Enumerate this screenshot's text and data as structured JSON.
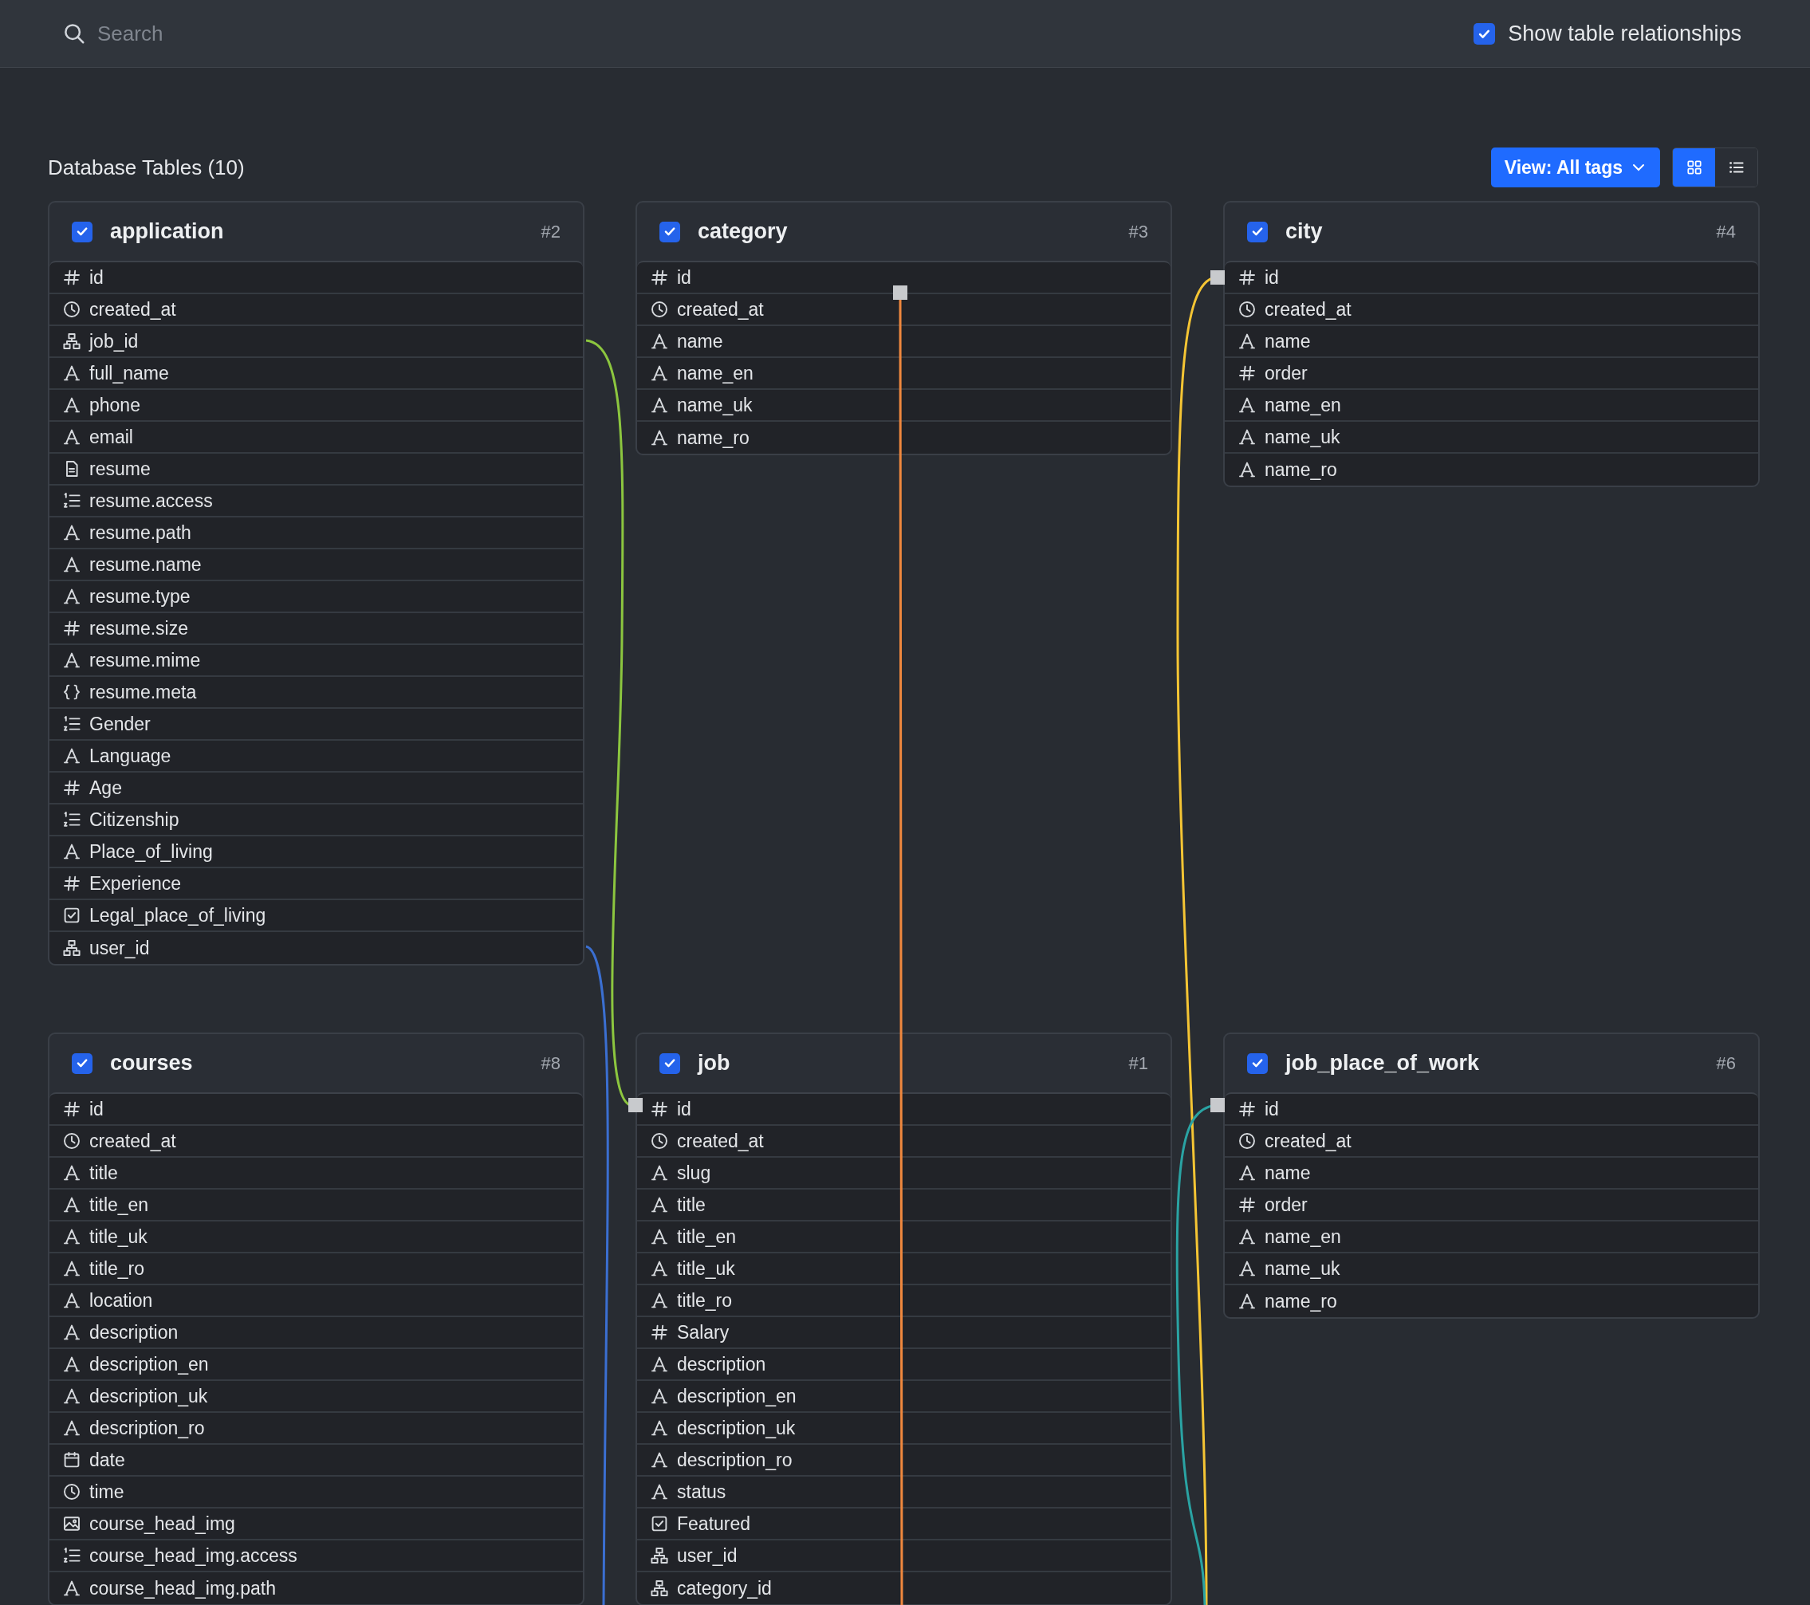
{
  "search": {
    "placeholder": "Search"
  },
  "show_relationships": {
    "label": "Show table relationships",
    "checked": true
  },
  "section_title": "Database Tables (10)",
  "view_button": {
    "label": "View: All tags"
  },
  "view_modes": [
    {
      "kind": "grid",
      "selected": true
    },
    {
      "kind": "list",
      "selected": false
    }
  ],
  "tables": [
    {
      "name": "application",
      "number": "#2",
      "checked": true,
      "fields": [
        {
          "name": "id",
          "kind": "number"
        },
        {
          "name": "created_at",
          "kind": "timestamp"
        },
        {
          "name": "job_id",
          "kind": "relation"
        },
        {
          "name": "full_name",
          "kind": "text"
        },
        {
          "name": "phone",
          "kind": "text"
        },
        {
          "name": "email",
          "kind": "text"
        },
        {
          "name": "resume",
          "kind": "file"
        },
        {
          "name": "resume.access",
          "kind": "list"
        },
        {
          "name": "resume.path",
          "kind": "text"
        },
        {
          "name": "resume.name",
          "kind": "text"
        },
        {
          "name": "resume.type",
          "kind": "text"
        },
        {
          "name": "resume.size",
          "kind": "number"
        },
        {
          "name": "resume.mime",
          "kind": "text"
        },
        {
          "name": "resume.meta",
          "kind": "json"
        },
        {
          "name": "Gender",
          "kind": "list"
        },
        {
          "name": "Language",
          "kind": "text"
        },
        {
          "name": "Age",
          "kind": "number"
        },
        {
          "name": "Citizenship",
          "kind": "list"
        },
        {
          "name": "Place_of_living",
          "kind": "text"
        },
        {
          "name": "Experience",
          "kind": "number"
        },
        {
          "name": "Legal_place_of_living",
          "kind": "boolean"
        },
        {
          "name": "user_id",
          "kind": "relation"
        }
      ]
    },
    {
      "name": "category",
      "number": "#3",
      "checked": true,
      "fields": [
        {
          "name": "id",
          "kind": "number"
        },
        {
          "name": "created_at",
          "kind": "timestamp"
        },
        {
          "name": "name",
          "kind": "text"
        },
        {
          "name": "name_en",
          "kind": "text"
        },
        {
          "name": "name_uk",
          "kind": "text"
        },
        {
          "name": "name_ro",
          "kind": "text"
        }
      ]
    },
    {
      "name": "city",
      "number": "#4",
      "checked": true,
      "fields": [
        {
          "name": "id",
          "kind": "number"
        },
        {
          "name": "created_at",
          "kind": "timestamp"
        },
        {
          "name": "name",
          "kind": "text"
        },
        {
          "name": "order",
          "kind": "number"
        },
        {
          "name": "name_en",
          "kind": "text"
        },
        {
          "name": "name_uk",
          "kind": "text"
        },
        {
          "name": "name_ro",
          "kind": "text"
        }
      ]
    },
    {
      "name": "courses",
      "number": "#8",
      "checked": true,
      "fields": [
        {
          "name": "id",
          "kind": "number"
        },
        {
          "name": "created_at",
          "kind": "timestamp"
        },
        {
          "name": "title",
          "kind": "text"
        },
        {
          "name": "title_en",
          "kind": "text"
        },
        {
          "name": "title_uk",
          "kind": "text"
        },
        {
          "name": "title_ro",
          "kind": "text"
        },
        {
          "name": "location",
          "kind": "text"
        },
        {
          "name": "description",
          "kind": "text"
        },
        {
          "name": "description_en",
          "kind": "text"
        },
        {
          "name": "description_uk",
          "kind": "text"
        },
        {
          "name": "description_ro",
          "kind": "text"
        },
        {
          "name": "date",
          "kind": "date"
        },
        {
          "name": "time",
          "kind": "timestamp"
        },
        {
          "name": "course_head_img",
          "kind": "image"
        },
        {
          "name": "course_head_img.access",
          "kind": "list"
        },
        {
          "name": "course_head_img.path",
          "kind": "text"
        }
      ]
    },
    {
      "name": "job",
      "number": "#1",
      "checked": true,
      "fields": [
        {
          "name": "id",
          "kind": "number"
        },
        {
          "name": "created_at",
          "kind": "timestamp"
        },
        {
          "name": "slug",
          "kind": "text"
        },
        {
          "name": "title",
          "kind": "text"
        },
        {
          "name": "title_en",
          "kind": "text"
        },
        {
          "name": "title_uk",
          "kind": "text"
        },
        {
          "name": "title_ro",
          "kind": "text"
        },
        {
          "name": "Salary",
          "kind": "number"
        },
        {
          "name": "description",
          "kind": "text"
        },
        {
          "name": "description_en",
          "kind": "text"
        },
        {
          "name": "description_uk",
          "kind": "text"
        },
        {
          "name": "description_ro",
          "kind": "text"
        },
        {
          "name": "status",
          "kind": "text"
        },
        {
          "name": "Featured",
          "kind": "boolean"
        },
        {
          "name": "user_id",
          "kind": "relation"
        },
        {
          "name": "category_id",
          "kind": "relation"
        }
      ]
    },
    {
      "name": "job_place_of_work",
      "number": "#6",
      "checked": true,
      "fields": [
        {
          "name": "id",
          "kind": "number"
        },
        {
          "name": "created_at",
          "kind": "timestamp"
        },
        {
          "name": "name",
          "kind": "text"
        },
        {
          "name": "order",
          "kind": "number"
        },
        {
          "name": "name_en",
          "kind": "text"
        },
        {
          "name": "name_uk",
          "kind": "text"
        },
        {
          "name": "name_ro",
          "kind": "text"
        }
      ]
    }
  ],
  "relationships": [
    {
      "color": "#8cc63f"
    },
    {
      "color": "#3b6fd1"
    },
    {
      "color": "#f0883e"
    },
    {
      "color": "#f5c534"
    },
    {
      "color": "#2aa3a3"
    }
  ]
}
